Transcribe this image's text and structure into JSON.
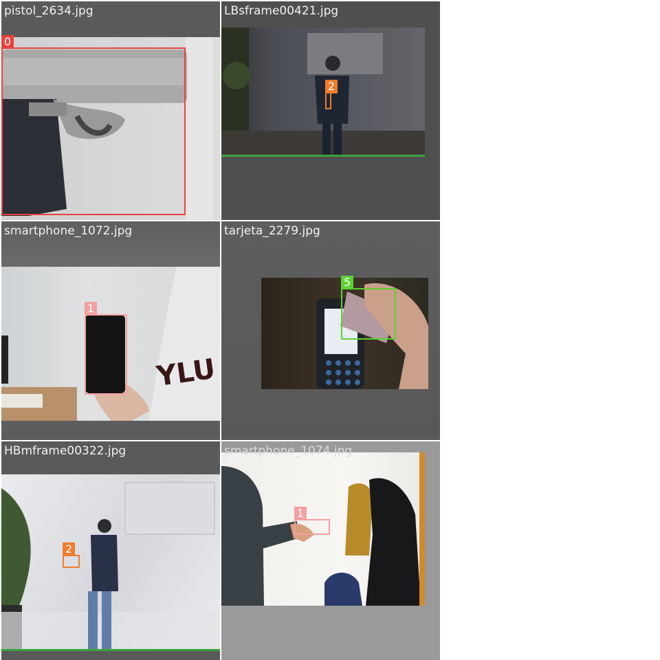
{
  "tiles": [
    {
      "filename": "pistol_2634.jpg",
      "detections": [
        {
          "class_id": "0",
          "color": "#e8413d"
        }
      ]
    },
    {
      "filename": "LBsframe00421.jpg",
      "detections": [
        {
          "class_id": "2",
          "color": "#f07c2c"
        }
      ]
    },
    {
      "filename": "smartphone_1072.jpg",
      "detections": [
        {
          "class_id": "1",
          "color": "#f4a0a0"
        }
      ]
    },
    {
      "filename": "tarjeta_2279.jpg",
      "detections": [
        {
          "class_id": "5",
          "color": "#5ad232"
        }
      ]
    },
    {
      "filename": "HBmframe00322.jpg",
      "detections": [
        {
          "class_id": "2",
          "color": "#f07c2c"
        }
      ]
    },
    {
      "filename": "smartphone_1074.jpg",
      "detections": [
        {
          "class_id": "1",
          "color": "#f4a0a0"
        }
      ]
    }
  ]
}
